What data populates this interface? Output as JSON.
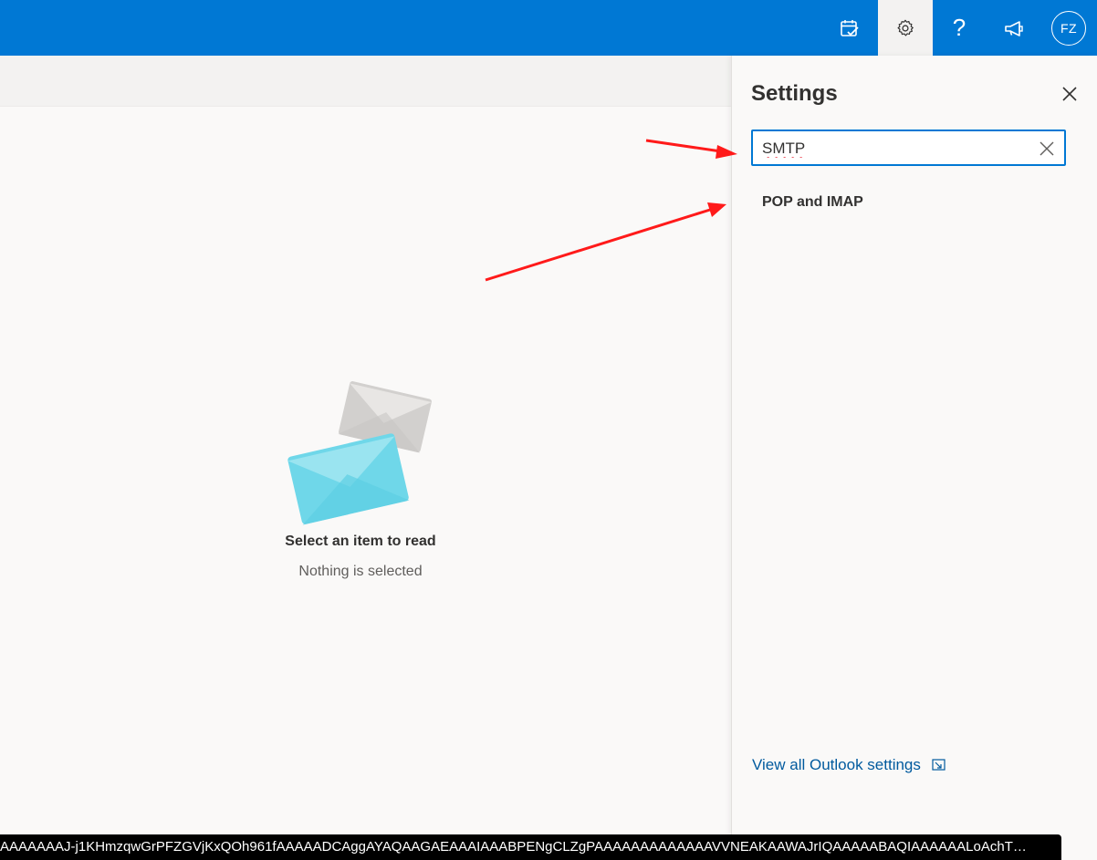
{
  "topbar": {
    "icons": [
      "my-day-icon",
      "gear-icon",
      "help-icon",
      "megaphone-icon"
    ],
    "help_glyph": "?",
    "avatar_initials": "FZ",
    "accent_color": "#0078d4"
  },
  "reading_pane": {
    "empty_title": "Select an item to read",
    "empty_subtitle": "Nothing is selected"
  },
  "settings_panel": {
    "title": "Settings",
    "search": {
      "value": "SMTP"
    },
    "results": [
      {
        "label": "POP and IMAP"
      }
    ],
    "view_all_label": "View all Outlook settings"
  },
  "status_url": "AAAAAAAJ-j1KHmzqwGrPFZGVjKxQOh961fAAAAADCAggAYAQAAGAEAAAIAAABPENgCLZgPAAAAAAAAAAAAAVVNEAKAAWAJrIQAAAAABAQIAAAAAALoAchT…"
}
